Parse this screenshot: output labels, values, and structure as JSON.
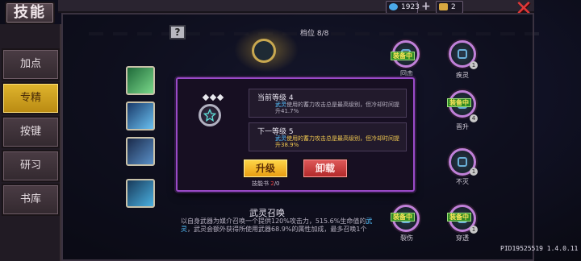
{
  "header": {
    "title": "技能"
  },
  "resources": {
    "gems": "1923",
    "plus": "+",
    "tokens": "2"
  },
  "sidebar": {
    "items": [
      {
        "label": "加点",
        "active": false
      },
      {
        "label": "专精",
        "active": true
      },
      {
        "label": "按键",
        "active": false
      },
      {
        "label": "研习",
        "active": false
      },
      {
        "label": "书库",
        "active": false
      }
    ]
  },
  "panel": {
    "help": "?",
    "rank": "档位 8/8"
  },
  "tree": {
    "nodes": [
      {
        "label": "回击",
        "equipped": true,
        "level": ""
      },
      {
        "label": "疾灵",
        "equipped": false,
        "level": "1"
      },
      {
        "label": "",
        "equipped": true,
        "level": "4"
      },
      {
        "label": "晋升",
        "equipped": false,
        "level": ""
      },
      {
        "label": "",
        "equipped": false,
        "level": ""
      },
      {
        "label": "不灭",
        "equipped": false,
        "level": "1"
      },
      {
        "label": "裂伤",
        "equipped": true,
        "level": ""
      },
      {
        "label": "穿透",
        "equipped": true,
        "level": "1"
      }
    ],
    "equipped_badge": "装备中"
  },
  "popup": {
    "current_header": "当前等级 4",
    "current_desc_prefix": "武灵",
    "current_desc_rest": "使用的蓄力攻击总是最高级别，但冷却时间提升41.7%",
    "next_header": "下一等级 5",
    "next_desc_prefix": "武灵",
    "next_desc_rest": "使用的蓄力攻击总是最高级别，但冷却时间提升38.9%",
    "upgrade_label": "升级",
    "unequip_label": "卸载",
    "book_label": "技能书 ",
    "book_current": "2",
    "book_total": "/0"
  },
  "skill": {
    "name": "武灵召唤",
    "desc_a": "以自身武器为媒介召唤一个提供120%攻击力，515.6%生命值的",
    "desc_hl": "武灵",
    "desc_b": "，武灵会额外获得所使用武器68.9%的属性加成，最多召唤1个"
  },
  "build": "PID19525519 1.4.0.11",
  "colors": {
    "accent": "#9a4ac8",
    "gold": "#e0b52e",
    "equipped": "#2e8a24",
    "close": "#e03838"
  }
}
